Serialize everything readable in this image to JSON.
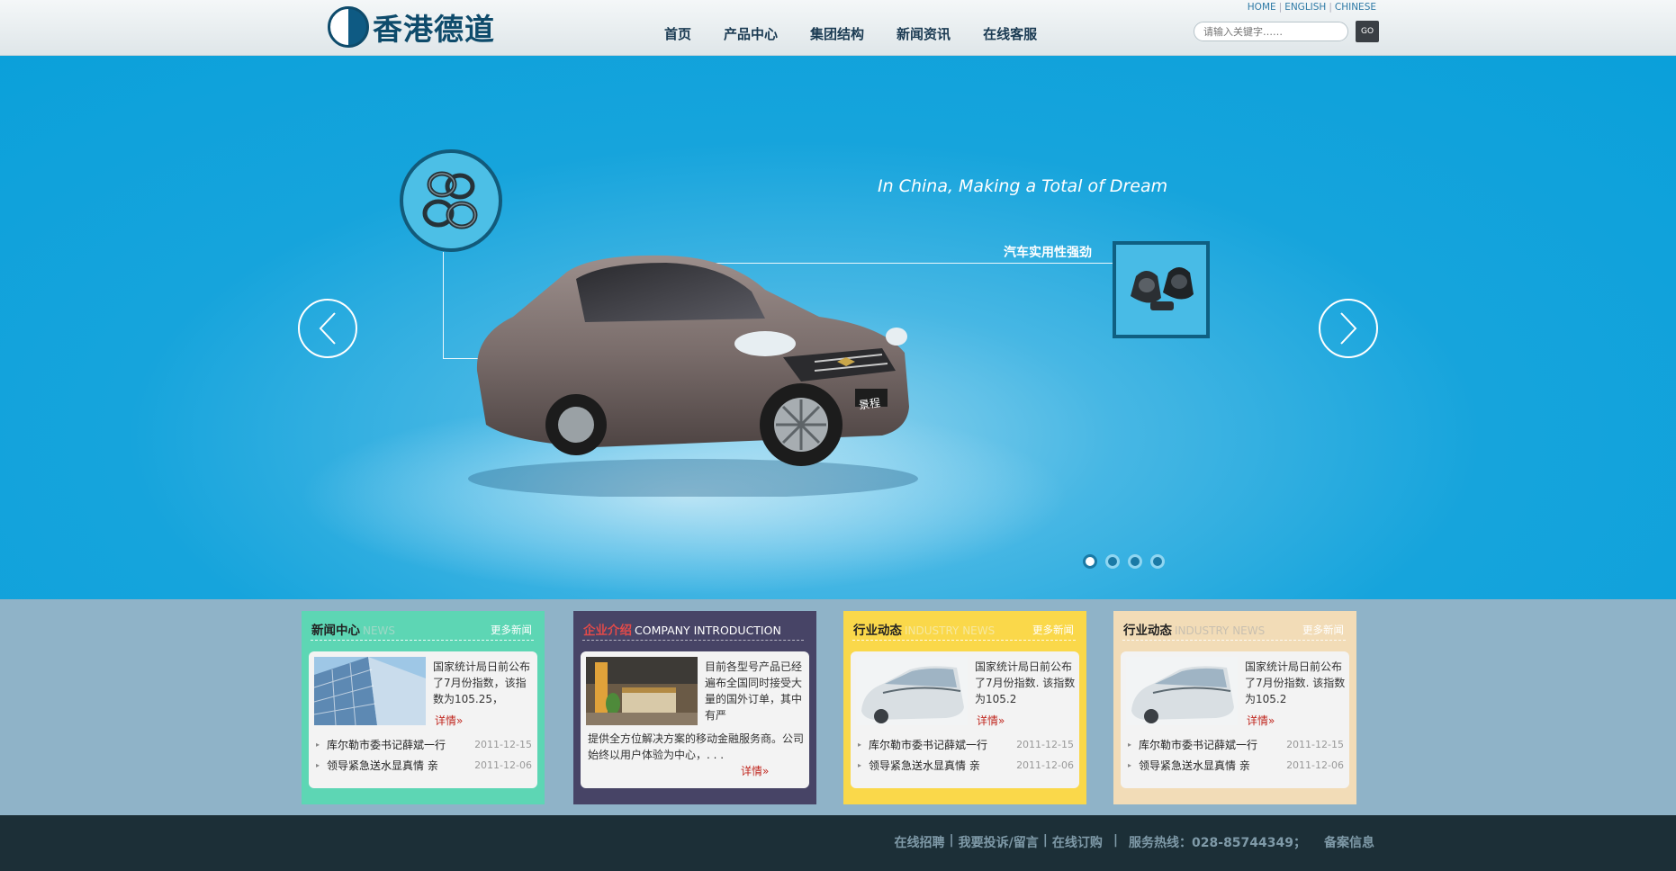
{
  "header": {
    "logo_text": "香港德道",
    "nav": [
      "首页",
      "产品中心",
      "集团结构",
      "新闻资讯",
      "在线客服"
    ],
    "lang": [
      "HOME",
      "ENGLISH",
      "CHINESE"
    ],
    "search_placeholder": "请输入关键字……",
    "search_button": "GO"
  },
  "banner": {
    "slogan": "In China, Making a Total of Dream",
    "callout": "汽车实用性强劲",
    "plate": "景程",
    "slides": 4,
    "active_slide": 1
  },
  "panels": [
    {
      "title": "新闻中心",
      "title_en": "NEWS",
      "more": "更多新闻",
      "summary": "国家统计局日前公布了7月份指数，该指数为105.25，",
      "detail": "详情",
      "items": [
        {
          "title": "库尔勒市委书记薛斌一行",
          "date": "2011-12-15"
        },
        {
          "title": "领导紧急送水显真情 亲",
          "date": "2011-12-06"
        }
      ]
    },
    {
      "title": "企业介绍",
      "title_en": "COMPANY INTRODUCTION",
      "summary": "目前各型号产品已经遍布全国同时接受大量的国外订单，其中有严",
      "body": "提供全方位解决方案的移动金融服务商。公司始终以用户体验为中心，. . .",
      "detail": "详情"
    },
    {
      "title": "行业动态",
      "title_en": "INDUSTRY NEWS",
      "more": "更多新闻",
      "summary": "国家统计局日前公布了7月份指数. 该指数为105.2",
      "detail": "详情",
      "items": [
        {
          "title": "库尔勒市委书记薛斌一行",
          "date": "2011-12-15"
        },
        {
          "title": "领导紧急送水显真情 亲",
          "date": "2011-12-06"
        }
      ]
    },
    {
      "title": "行业动态",
      "title_en": "INDUSTRY NEWS",
      "more": "更多新闻",
      "summary": "国家统计局日前公布了7月份指数. 该指数为105.2",
      "detail": "详情",
      "items": [
        {
          "title": "库尔勒市委书记薛斌一行",
          "date": "2011-12-15"
        },
        {
          "title": "领导紧急送水显真情 亲",
          "date": "2011-12-06"
        }
      ]
    }
  ],
  "footer": {
    "links": [
      "在线招聘",
      "我要投诉/留言",
      "在线订购"
    ],
    "hotline": "服务热线：028-85744349；",
    "record": "备案信息"
  },
  "colors": {
    "banner_blue": "#0aa0da",
    "panel_news": "#5dd6b4",
    "panel_company": "#474466",
    "panel_industry": "#fad84a",
    "panel_industry2": "#f2dcb7",
    "footer": "#1c2f37"
  }
}
